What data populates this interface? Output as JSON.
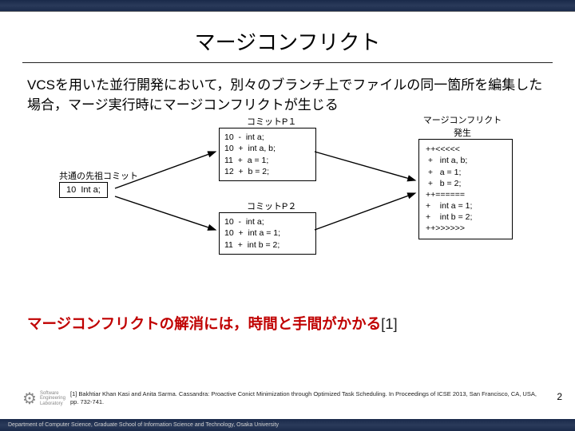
{
  "title": "マージコンフリクト",
  "paragraph": "VCSを用いた並行開発において，別々のブランチ上でファイルの同一箇所を編集した場合，マージ実行時にマージコンフリクトが生じる",
  "ancestor": {
    "label": "共通の先祖コミット",
    "content": "10  Int a;"
  },
  "commitP1": {
    "label": "コミットP１",
    "content": "10  -  int a;\n10  +  int a, b;\n11  +  a = 1;\n12  +  b = 2;"
  },
  "commitP2": {
    "label": "コミットP２",
    "content": "10  -  int a;\n10  +  int a = 1;\n11  +  int b = 2;"
  },
  "conflict": {
    "label": "マージコンフリクト\n発生",
    "content": "++<<<<<\n +   int a, b;\n +   a = 1;\n +   b = 2;\n++======\n+    int a = 1;\n+    int b = 2;\n++>>>>>>"
  },
  "conclusion": {
    "text": "マージコンフリクトの解消には，時間と手間がかかる",
    "ref": "[1]"
  },
  "citation": "[1] Bakhtiar Khan Kasi and Anita Sarma. Cassandra: Proactive Conict Minimization through Optimized Task Scheduling. In Proceedings of ICSE 2013, San Francisco, CA, USA, pp. 732-741.",
  "pageNumber": "2",
  "logo": {
    "line1": "Software",
    "line2": "Engineering",
    "line3": "Laboratory"
  },
  "footer": "Department of Computer Science, Graduate School of Information Science and Technology, Osaka University"
}
